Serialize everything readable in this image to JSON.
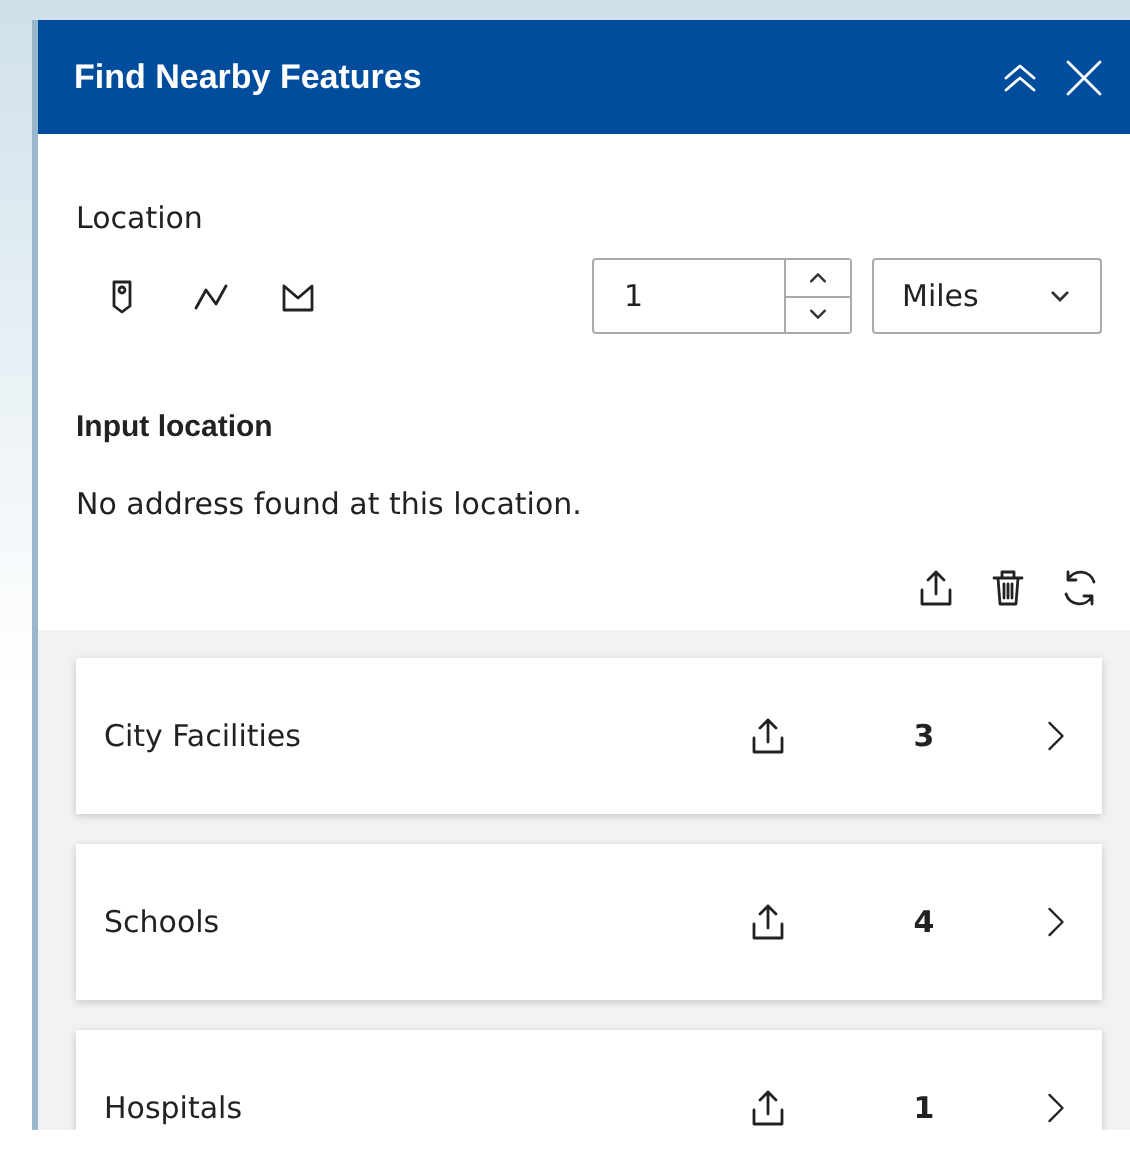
{
  "panel": {
    "title": "Find Nearby Features"
  },
  "location": {
    "label": "Location",
    "distance": "1",
    "unit": "Miles"
  },
  "input_location": {
    "label": "Input location",
    "message": "No address found at this location."
  },
  "results": [
    {
      "name": "City Facilities",
      "count": "3"
    },
    {
      "name": "Schools",
      "count": "4"
    },
    {
      "name": "Hospitals",
      "count": "1"
    }
  ]
}
